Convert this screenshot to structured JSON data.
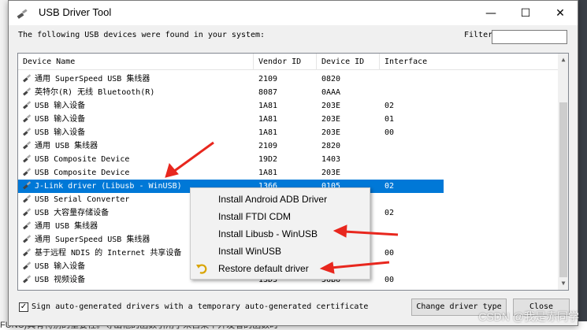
{
  "window": {
    "title": "USB Driver Tool",
    "minimize": "—",
    "maximize": "☐",
    "close": "✕"
  },
  "intro_text": "The following USB devices were found in your system:",
  "filter": {
    "label": "Filter",
    "value": ""
  },
  "table": {
    "headers": [
      "Device Name",
      "Vendor ID",
      "Device ID",
      "Interface"
    ],
    "rows": [
      {
        "name": "通用 SuperSpeed USB 集线器",
        "vendor": "2109",
        "device": "0820",
        "iface": ""
      },
      {
        "name": "英特尔(R) 无线 Bluetooth(R)",
        "vendor": "8087",
        "device": "0AAA",
        "iface": ""
      },
      {
        "name": "USB 输入设备",
        "vendor": "1A81",
        "device": "203E",
        "iface": "02"
      },
      {
        "name": "USB 输入设备",
        "vendor": "1A81",
        "device": "203E",
        "iface": "01"
      },
      {
        "name": "USB 输入设备",
        "vendor": "1A81",
        "device": "203E",
        "iface": "00"
      },
      {
        "name": "通用 USB 集线器",
        "vendor": "2109",
        "device": "2820",
        "iface": ""
      },
      {
        "name": "USB Composite Device",
        "vendor": "19D2",
        "device": "1403",
        "iface": ""
      },
      {
        "name": "USB Composite Device",
        "vendor": "1A81",
        "device": "203E",
        "iface": ""
      },
      {
        "name": "J-Link driver (Libusb - WinUSB)",
        "vendor": "1366",
        "device": "0105",
        "iface": "02"
      },
      {
        "name": "USB Serial Converter",
        "vendor": "",
        "device": "",
        "iface": ""
      },
      {
        "name": "USB 大容量存储设备",
        "vendor": "",
        "device": "",
        "iface": "02"
      },
      {
        "name": "通用 USB 集线器",
        "vendor": "",
        "device": "",
        "iface": ""
      },
      {
        "name": "通用 SuperSpeed USB 集线器",
        "vendor": "",
        "device": "",
        "iface": ""
      },
      {
        "name": "基于远程 NDIS 的 Internet 共享设备",
        "vendor": "",
        "device": "",
        "iface": "00"
      },
      {
        "name": "USB 输入设备",
        "vendor": "",
        "device": "",
        "iface": ""
      },
      {
        "name": "USB 视频设备",
        "vendor": "13D3",
        "device": "56B6",
        "iface": "00"
      }
    ],
    "selected_index": 8
  },
  "context_menu": {
    "items": [
      "Install Android ADB Driver",
      "Install FTDI CDM",
      "Install Libusb - WinUSB",
      "Install WinUSB",
      "Restore default driver"
    ]
  },
  "checkbox": {
    "checked": "✓",
    "label": "Sign auto-generated drivers with a temporary auto-generated certificate"
  },
  "buttons": {
    "change_driver_type": "Change driver type",
    "close": "Close"
  },
  "watermark": "CSDN @我是赤同学",
  "background_text": "FUNC)具有特别的重要性。导出他的函数引用了来自某个开发者的函数时"
}
